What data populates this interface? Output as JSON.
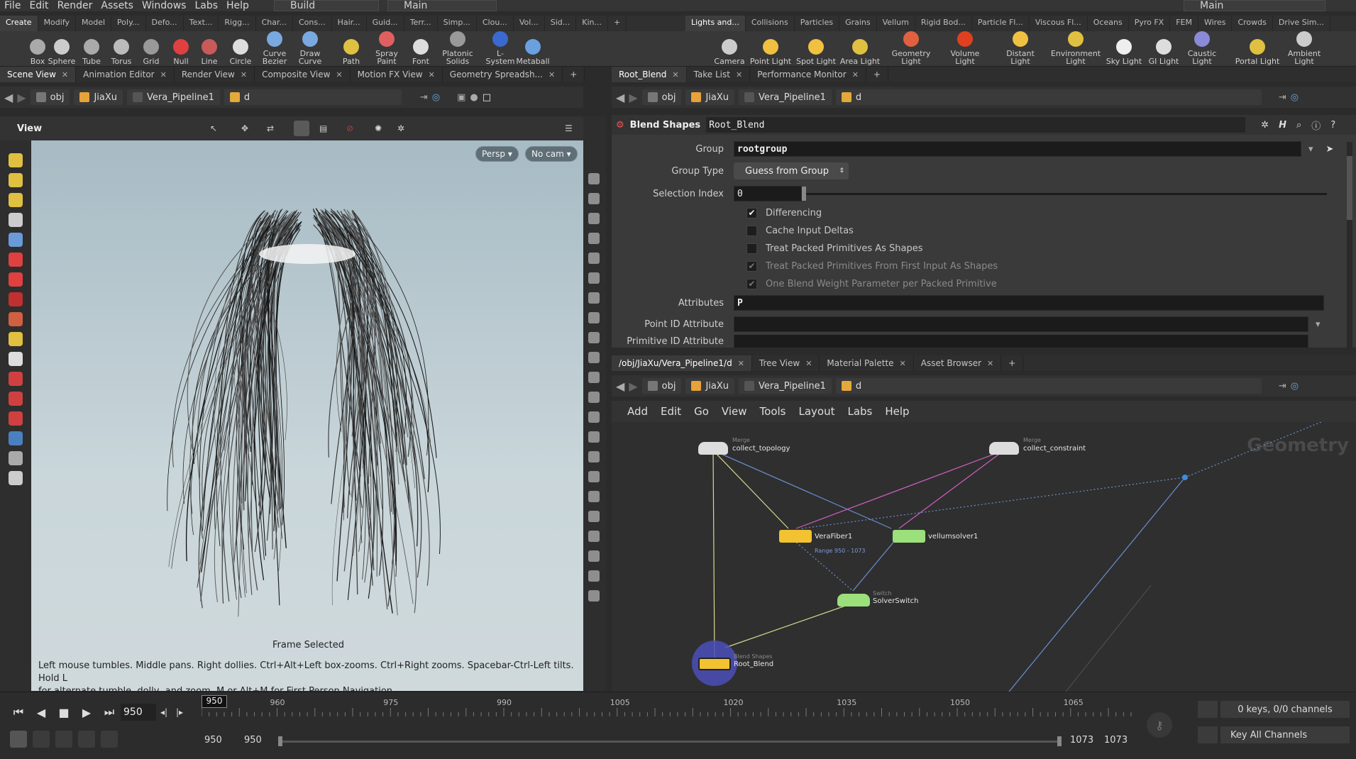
{
  "menubar": {
    "items": [
      "File",
      "Edit",
      "Render",
      "Assets",
      "Windows",
      "Labs",
      "Help"
    ],
    "desktop": "Build",
    "layout": "Main",
    "right_layout": "Main"
  },
  "shelf_tabs_left": [
    "Create",
    "Modify",
    "Model",
    "Poly...",
    "Defo...",
    "Text...",
    "Rigg...",
    "Char...",
    "Cons...",
    "Hair...",
    "Guid...",
    "Terr...",
    "Simp...",
    "Clou...",
    "Vol...",
    "Sid...",
    "Kin..."
  ],
  "shelf_tabs_right": [
    "Lights and...",
    "Collisions",
    "Particles",
    "Grains",
    "Vellum",
    "Rigid Bod...",
    "Particle Fl...",
    "Viscous Fl...",
    "Oceans",
    "Pyro FX",
    "FEM",
    "Wires",
    "Crowds",
    "Drive Sim..."
  ],
  "shelf_tools_left": [
    "Box",
    "Sphere",
    "Tube",
    "Torus",
    "Grid",
    "Null",
    "Line",
    "Circle",
    "Curve Bezier",
    "Draw Curve",
    "Path",
    "Spray Paint",
    "Font",
    "Platonic Solids",
    "L-System",
    "Metaball"
  ],
  "shelf_tools_right": [
    "Camera",
    "Point Light",
    "Spot Light",
    "Area Light",
    "Geometry Light",
    "Volume Light",
    "Distant Light",
    "Environment Light",
    "Sky Light",
    "GI Light",
    "Caustic Light",
    "Portal Light",
    "Ambient Light"
  ],
  "left_tabs": [
    "Scene View",
    "Animation Editor",
    "Render View",
    "Composite View",
    "Motion FX View",
    "Geometry Spreadsh..."
  ],
  "path": {
    "obj": "obj",
    "jiaxu": "JiaXu",
    "pipeline": "Vera_Pipeline1",
    "node": "d"
  },
  "viewport": {
    "label": "View",
    "persp": "Persp",
    "cam": "No cam",
    "frame_selected": "Frame Selected",
    "hint1": "Left mouse tumbles. Middle pans. Right dollies. Ctrl+Alt+Left box-zooms. Ctrl+Right zooms. Spacebar-Ctrl-Left tilts. Hold L",
    "hint2": "for alternate tumble, dolly, and zoom.     M or Alt+M for First Person Navigation."
  },
  "right_top_tabs": [
    "Root_Blend",
    "Take List",
    "Performance Monitor"
  ],
  "params": {
    "node_type": "Blend Shapes",
    "node_name": "Root_Blend",
    "group_label": "Group",
    "group_value": "rootgroup",
    "group_type_label": "Group Type",
    "group_type_value": "Guess from Group",
    "selection_index_label": "Selection Index",
    "selection_index_value": "0",
    "differencing": "Differencing",
    "cache_input": "Cache Input Deltas",
    "treat_packed": "Treat Packed Primitives As Shapes",
    "treat_packed_first": "Treat Packed Primitives From First Input As Shapes",
    "one_blend": "One Blend Weight Parameter per Packed Primitive",
    "attributes_label": "Attributes",
    "attributes_value": "P",
    "point_id_label": "Point ID Attribute",
    "prim_id_label": "Primitive ID Attribute"
  },
  "net_tabs": [
    "/obj/JiaXu/Vera_Pipeline1/d",
    "Tree View",
    "Material Palette",
    "Asset Browser"
  ],
  "net_menu": [
    "Add",
    "Edit",
    "Go",
    "View",
    "Tools",
    "Layout",
    "Labs",
    "Help"
  ],
  "network": {
    "context": "Geometry",
    "nodes": [
      {
        "name": "collect_topology",
        "type": "Merge"
      },
      {
        "name": "collect_constraint",
        "type": "Merge"
      },
      {
        "name": "VeraFiber1",
        "type": "",
        "info": "Range 950 - 1073"
      },
      {
        "name": "vellumsolver1",
        "type": ""
      },
      {
        "name": "SolverSwitch",
        "type": "Switch"
      },
      {
        "name": "Root_Blend",
        "type": "Blend Shapes"
      }
    ]
  },
  "timeline": {
    "current_frame": "950",
    "ticks": [
      "960",
      "975",
      "990",
      "1005",
      "1020",
      "1035",
      "1050",
      "1065"
    ],
    "start": "950",
    "start2": "950",
    "end": "1073",
    "end2": "1073",
    "keys": "0 keys, 0/0 channels",
    "key_all": "Key All Channels"
  },
  "colors": {
    "accent": "#f0c040",
    "node_green": "#9be07a",
    "node_yellow": "#f2c230"
  }
}
